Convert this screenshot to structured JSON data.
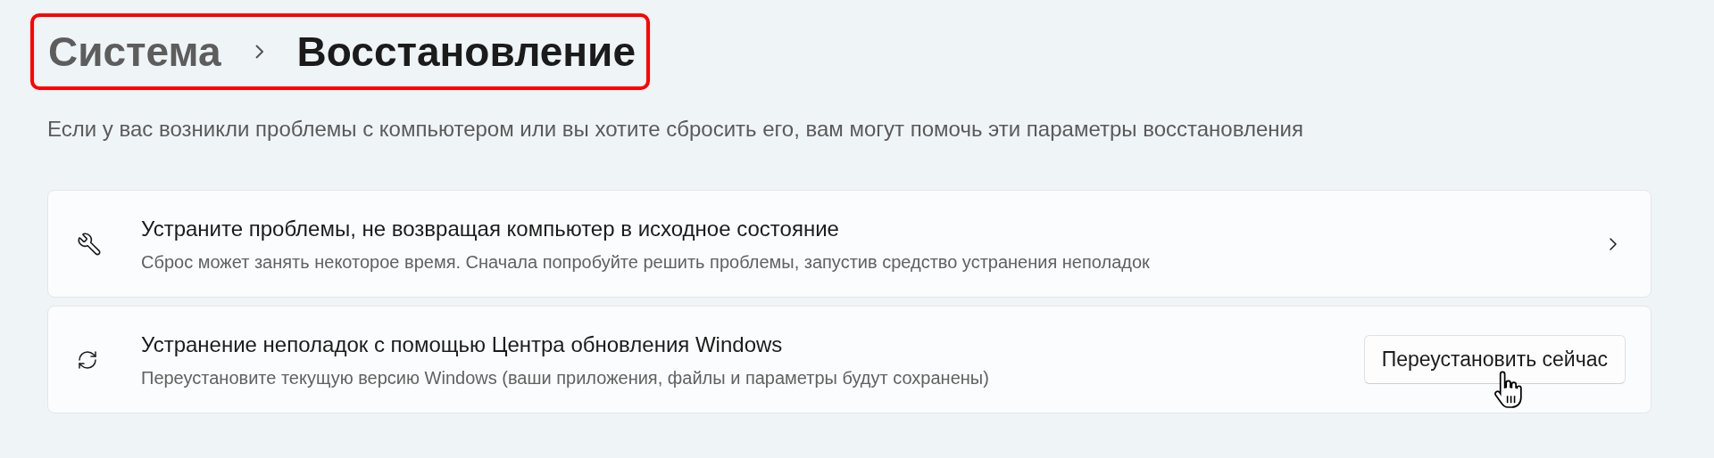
{
  "breadcrumb": {
    "items": [
      "Система",
      "Восстановление"
    ]
  },
  "description": "Если у вас возникли проблемы с компьютером или вы хотите сбросить его, вам могут помочь эти параметры восстановления",
  "options": [
    {
      "kind": "link",
      "title": "Устраните проблемы, не возвращая компьютер в исходное состояние",
      "subtitle": "Сброс может занять некоторое время. Сначала попробуйте решить проблемы, запустив средство устранения неполадок"
    },
    {
      "kind": "button",
      "title": "Устранение неполадок с помощью Центра обновления Windows",
      "subtitle": "Переустановите текущую версию Windows (ваши приложения, файлы и параметры будут сохранены)",
      "button": "Переустановить сейчас"
    }
  ]
}
